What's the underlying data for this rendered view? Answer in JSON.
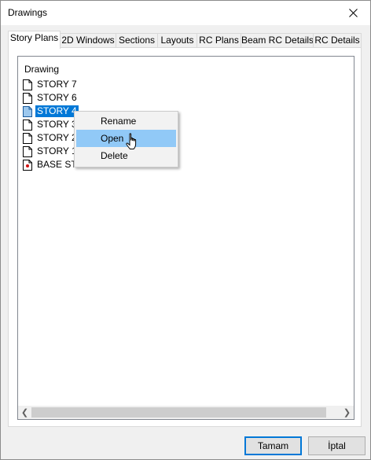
{
  "window": {
    "title": "Drawings"
  },
  "tabs": [
    {
      "label": "Story Plans",
      "active": true
    },
    {
      "label": "2D Windows"
    },
    {
      "label": "Sections"
    },
    {
      "label": "Layouts"
    },
    {
      "label": "RC Plans"
    },
    {
      "label": "Beam RC Details"
    },
    {
      "label": "RC Details"
    }
  ],
  "tree": {
    "header": "Drawing",
    "items": [
      {
        "label": "STORY 7",
        "icon": "document-icon"
      },
      {
        "label": "STORY 6",
        "icon": "document-icon"
      },
      {
        "label": "STORY 4",
        "icon": "document-icon",
        "selected": true
      },
      {
        "label": "STORY 3",
        "icon": "document-icon"
      },
      {
        "label": "STORY 2",
        "icon": "document-icon"
      },
      {
        "label": "STORY 1",
        "icon": "document-icon"
      },
      {
        "label": "BASE STORY",
        "icon": "base-story-icon"
      }
    ]
  },
  "context_menu": {
    "items": [
      {
        "label": "Rename"
      },
      {
        "label": "Open",
        "hover": true
      },
      {
        "label": "Delete"
      }
    ]
  },
  "buttons": {
    "ok": "Tamam",
    "cancel": "İptal"
  }
}
